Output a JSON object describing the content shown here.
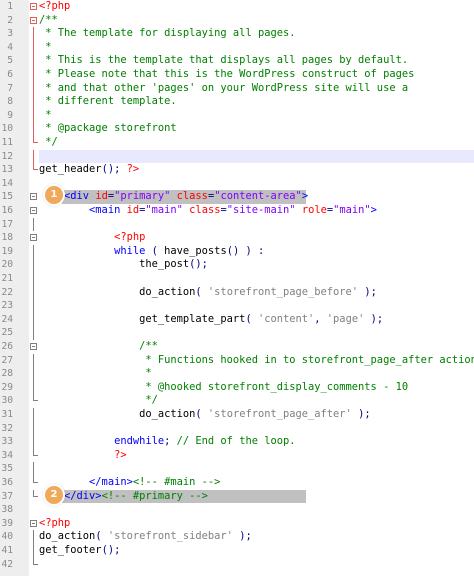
{
  "editor": {
    "lines": [
      {
        "n": "1",
        "parts": [
          {
            "c": "t-php",
            "t": "<?php"
          }
        ]
      },
      {
        "n": "2",
        "parts": [
          {
            "c": "t-cm",
            "t": "/**"
          }
        ]
      },
      {
        "n": "3",
        "parts": [
          {
            "c": "t-cm",
            "t": " * The template for displaying all pages."
          }
        ]
      },
      {
        "n": "4",
        "parts": [
          {
            "c": "t-cm",
            "t": " *"
          }
        ]
      },
      {
        "n": "5",
        "parts": [
          {
            "c": "t-cm",
            "t": " * This is the template that displays all pages by default."
          }
        ]
      },
      {
        "n": "6",
        "parts": [
          {
            "c": "t-cm",
            "t": " * Please note that this is the WordPress construct of pages"
          }
        ]
      },
      {
        "n": "7",
        "parts": [
          {
            "c": "t-cm",
            "t": " * and that other 'pages' on your WordPress site will use a"
          }
        ]
      },
      {
        "n": "8",
        "parts": [
          {
            "c": "t-cm",
            "t": " * different template."
          }
        ]
      },
      {
        "n": "9",
        "parts": [
          {
            "c": "t-cm",
            "t": " *"
          }
        ]
      },
      {
        "n": "10",
        "parts": [
          {
            "c": "t-cm",
            "t": " * @package storefront"
          }
        ]
      },
      {
        "n": "11",
        "parts": [
          {
            "c": "t-cm",
            "t": " */"
          }
        ]
      },
      {
        "n": "12",
        "parts": []
      },
      {
        "n": "13",
        "parts": [
          {
            "c": "t-fn",
            "t": "get_header"
          },
          {
            "c": "t-op",
            "t": "(); "
          },
          {
            "c": "t-php",
            "t": "?>"
          }
        ]
      },
      {
        "n": "14",
        "parts": []
      },
      {
        "n": "15",
        "parts": [
          {
            "c": "",
            "t": "    "
          },
          {
            "c": "t-tag",
            "t": "<div "
          },
          {
            "c": "t-attr",
            "t": "id"
          },
          {
            "c": "t-op",
            "t": "="
          },
          {
            "c": "t-val",
            "t": "\"primary\""
          },
          {
            "c": "t-attr",
            "t": " class"
          },
          {
            "c": "t-op",
            "t": "="
          },
          {
            "c": "t-val",
            "t": "\"content-area\""
          },
          {
            "c": "t-tag",
            "t": ">"
          }
        ]
      },
      {
        "n": "16",
        "parts": [
          {
            "c": "",
            "t": "        "
          },
          {
            "c": "t-tag",
            "t": "<main "
          },
          {
            "c": "t-attr",
            "t": "id"
          },
          {
            "c": "t-op",
            "t": "="
          },
          {
            "c": "t-val",
            "t": "\"main\""
          },
          {
            "c": "t-attr",
            "t": " class"
          },
          {
            "c": "t-op",
            "t": "="
          },
          {
            "c": "t-val",
            "t": "\"site-main\""
          },
          {
            "c": "t-attr",
            "t": " role"
          },
          {
            "c": "t-op",
            "t": "="
          },
          {
            "c": "t-val",
            "t": "\"main\""
          },
          {
            "c": "t-tag",
            "t": ">"
          }
        ]
      },
      {
        "n": "17",
        "parts": []
      },
      {
        "n": "18",
        "parts": [
          {
            "c": "",
            "t": "            "
          },
          {
            "c": "t-php",
            "t": "<?php"
          }
        ]
      },
      {
        "n": "19",
        "parts": [
          {
            "c": "",
            "t": "            "
          },
          {
            "c": "t-kw",
            "t": "while"
          },
          {
            "c": "t-op",
            "t": " ( "
          },
          {
            "c": "t-fn",
            "t": "have_posts"
          },
          {
            "c": "t-op",
            "t": "() ) :"
          }
        ]
      },
      {
        "n": "20",
        "parts": [
          {
            "c": "",
            "t": "                "
          },
          {
            "c": "t-fn",
            "t": "the_post"
          },
          {
            "c": "t-op",
            "t": "();"
          }
        ]
      },
      {
        "n": "21",
        "parts": []
      },
      {
        "n": "22",
        "parts": [
          {
            "c": "",
            "t": "                "
          },
          {
            "c": "t-fn",
            "t": "do_action"
          },
          {
            "c": "t-op",
            "t": "( "
          },
          {
            "c": "t-str",
            "t": "'storefront_page_before'"
          },
          {
            "c": "t-op",
            "t": " );"
          }
        ]
      },
      {
        "n": "23",
        "parts": []
      },
      {
        "n": "24",
        "parts": [
          {
            "c": "",
            "t": "                "
          },
          {
            "c": "t-fn",
            "t": "get_template_part"
          },
          {
            "c": "t-op",
            "t": "( "
          },
          {
            "c": "t-str",
            "t": "'content'"
          },
          {
            "c": "t-op",
            "t": ", "
          },
          {
            "c": "t-str",
            "t": "'page'"
          },
          {
            "c": "t-op",
            "t": " );"
          }
        ]
      },
      {
        "n": "25",
        "parts": []
      },
      {
        "n": "26",
        "parts": [
          {
            "c": "",
            "t": "                "
          },
          {
            "c": "t-cm",
            "t": "/**"
          }
        ]
      },
      {
        "n": "27",
        "parts": [
          {
            "c": "",
            "t": "                "
          },
          {
            "c": "t-cm",
            "t": " * Functions hooked in to storefront_page_after action"
          }
        ]
      },
      {
        "n": "28",
        "parts": [
          {
            "c": "",
            "t": "                "
          },
          {
            "c": "t-cm",
            "t": " *"
          }
        ]
      },
      {
        "n": "29",
        "parts": [
          {
            "c": "",
            "t": "                "
          },
          {
            "c": "t-cm",
            "t": " * @hooked storefront_display_comments - 10"
          }
        ]
      },
      {
        "n": "30",
        "parts": [
          {
            "c": "",
            "t": "                "
          },
          {
            "c": "t-cm",
            "t": " */"
          }
        ]
      },
      {
        "n": "31",
        "parts": [
          {
            "c": "",
            "t": "                "
          },
          {
            "c": "t-fn",
            "t": "do_action"
          },
          {
            "c": "t-op",
            "t": "( "
          },
          {
            "c": "t-str",
            "t": "'storefront_page_after'"
          },
          {
            "c": "t-op",
            "t": " );"
          }
        ]
      },
      {
        "n": "32",
        "parts": []
      },
      {
        "n": "33",
        "parts": [
          {
            "c": "",
            "t": "            "
          },
          {
            "c": "t-kw",
            "t": "endwhile"
          },
          {
            "c": "t-op",
            "t": "; "
          },
          {
            "c": "t-cm",
            "t": "// End of the loop."
          }
        ]
      },
      {
        "n": "34",
        "parts": [
          {
            "c": "",
            "t": "            "
          },
          {
            "c": "t-php",
            "t": "?>"
          }
        ]
      },
      {
        "n": "35",
        "parts": []
      },
      {
        "n": "36",
        "parts": [
          {
            "c": "",
            "t": "        "
          },
          {
            "c": "t-tag",
            "t": "</main>"
          },
          {
            "c": "t-html-cm",
            "t": "<!-- #main -->"
          }
        ]
      },
      {
        "n": "37",
        "parts": [
          {
            "c": "",
            "t": "    "
          },
          {
            "c": "t-tag",
            "t": "</div>"
          },
          {
            "c": "t-html-cm",
            "t": "<!-- #primary -->"
          }
        ]
      },
      {
        "n": "38",
        "parts": []
      },
      {
        "n": "39",
        "parts": [
          {
            "c": "t-php",
            "t": "<?php"
          }
        ]
      },
      {
        "n": "40",
        "parts": [
          {
            "c": "t-fn",
            "t": "do_action"
          },
          {
            "c": "t-op",
            "t": "( "
          },
          {
            "c": "t-str",
            "t": "'storefront_sidebar'"
          },
          {
            "c": "t-op",
            "t": " );"
          }
        ]
      },
      {
        "n": "41",
        "parts": [
          {
            "c": "t-fn",
            "t": "get_footer"
          },
          {
            "c": "t-op",
            "t": "();"
          }
        ]
      },
      {
        "n": "42",
        "parts": []
      }
    ],
    "badges": [
      {
        "label": "1"
      },
      {
        "label": "2"
      }
    ],
    "colors": {
      "php_tag": "#ff0000",
      "comment": "#008000",
      "keyword": "#0000ff",
      "string": "#808080",
      "attr_value": "#8000ff",
      "selection": "#c0c0c0",
      "current_line": "#e8e8ff",
      "badge": "#f0a85a"
    }
  }
}
